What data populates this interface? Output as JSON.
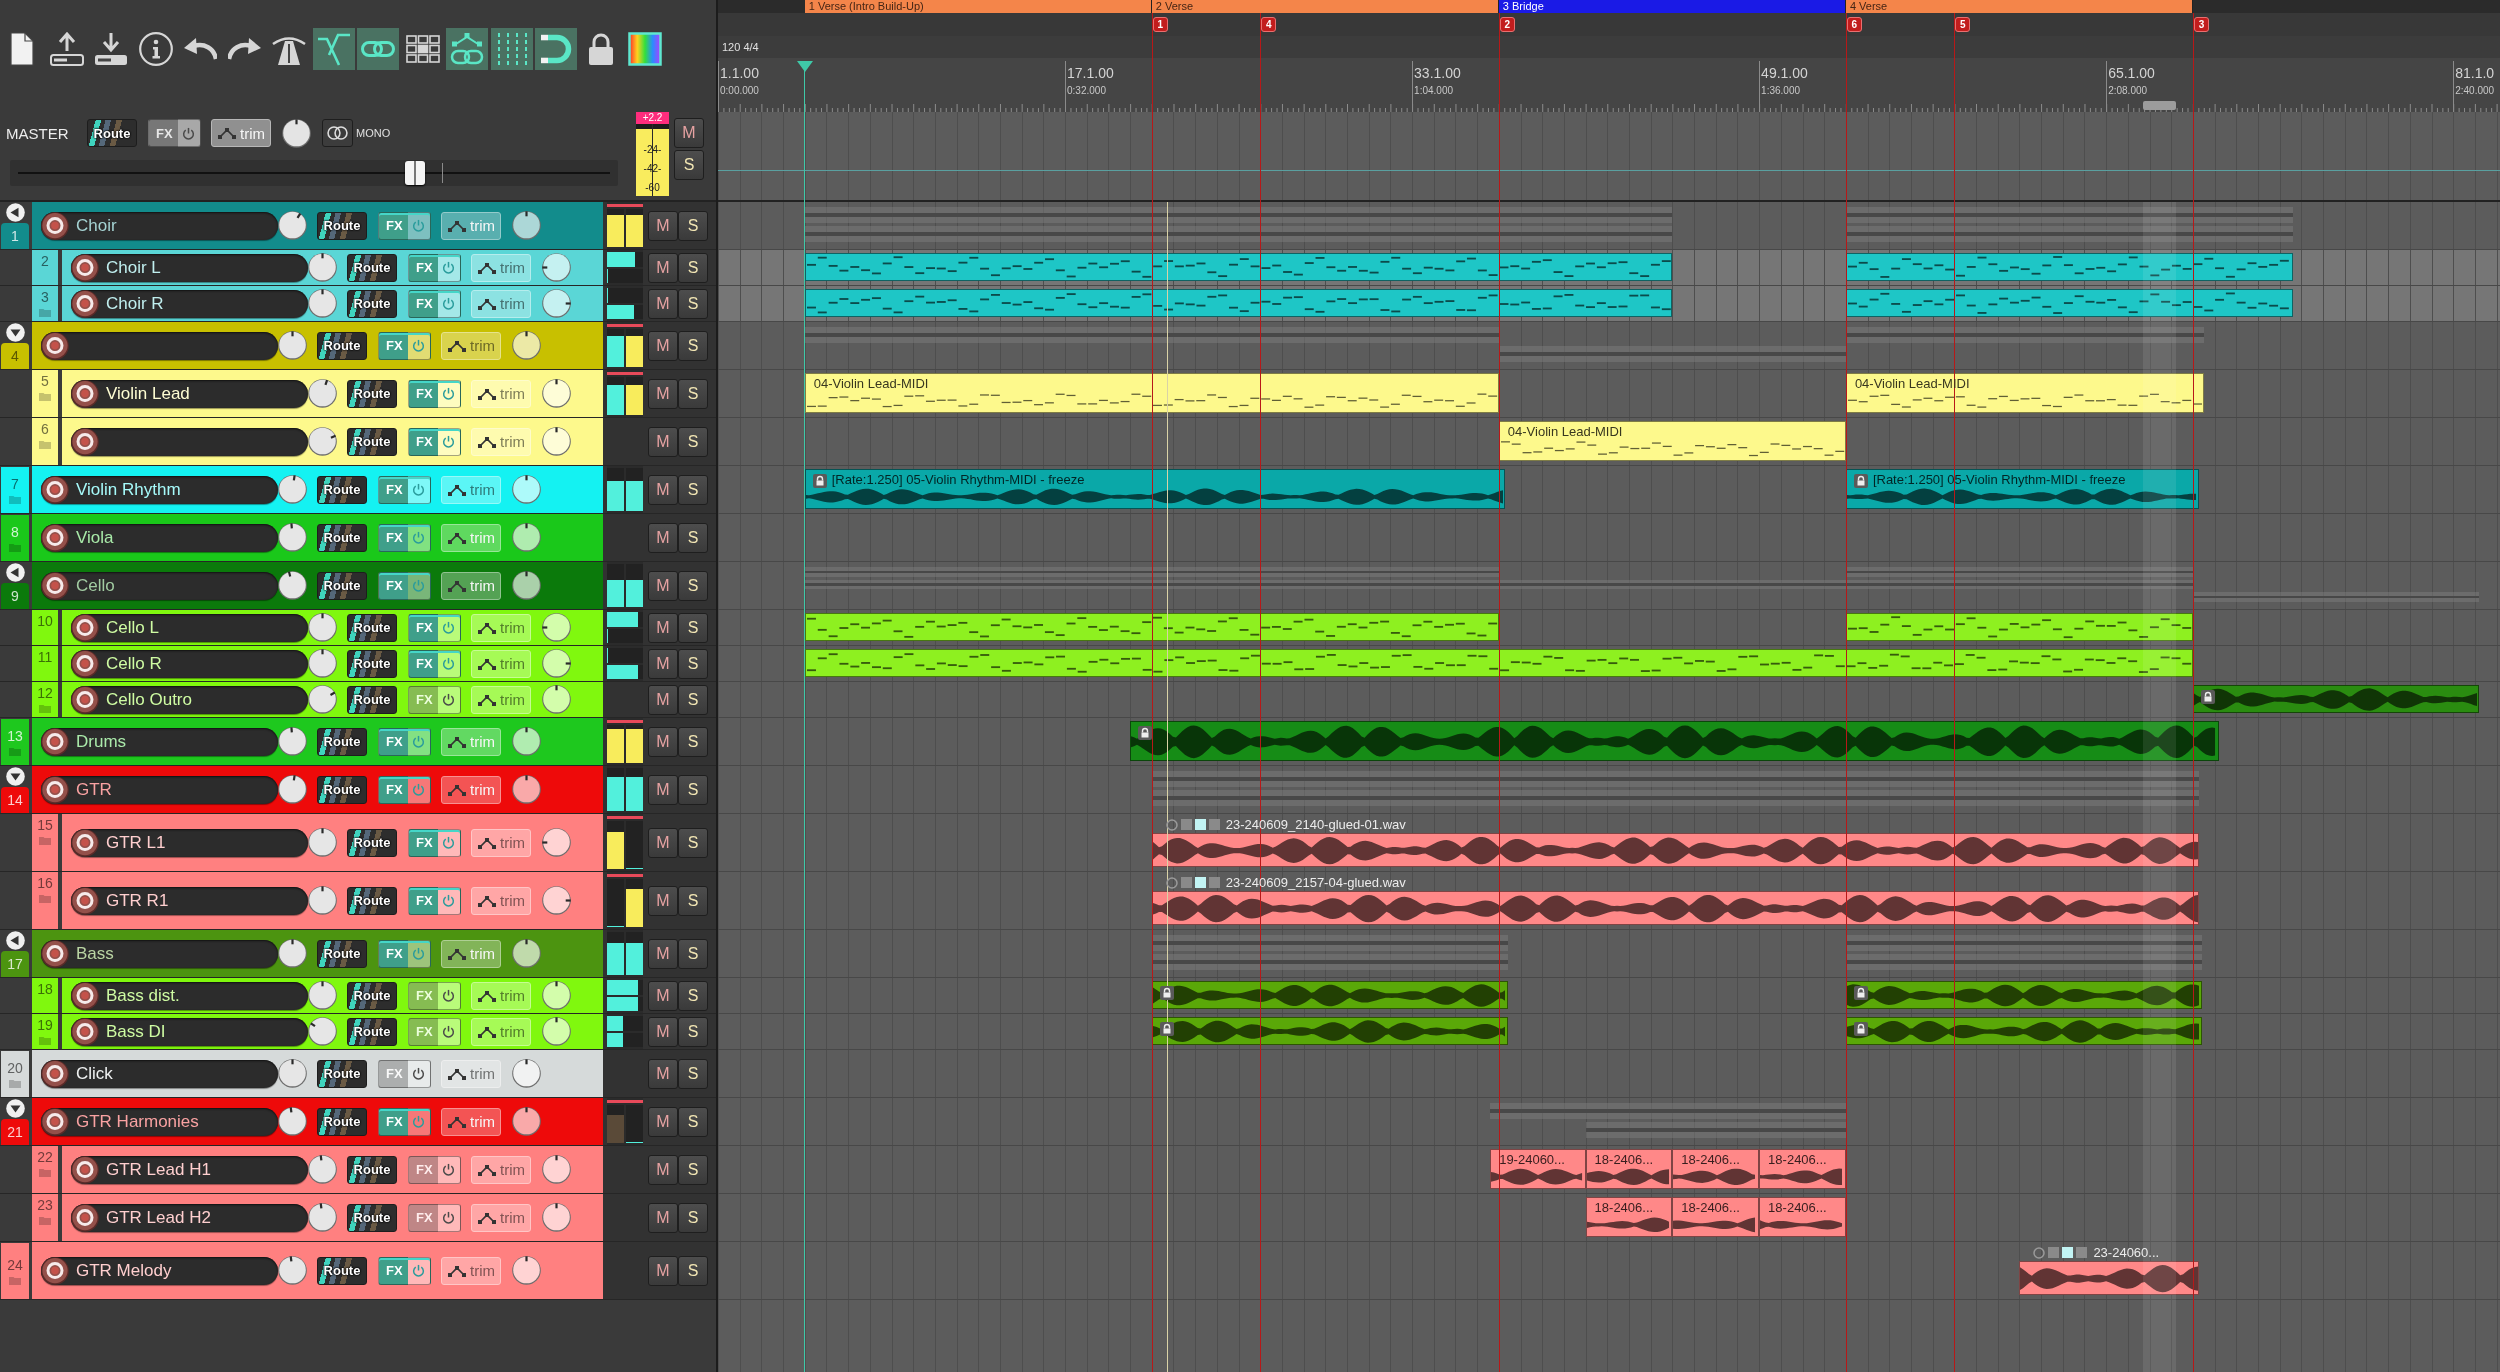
{
  "toolbar": [
    {
      "on": false
    },
    {
      "on": false
    },
    {
      "on": false
    },
    {
      "on": false
    },
    {
      "on": false
    },
    {
      "on": false
    },
    {
      "on": false
    },
    {
      "on": true
    },
    {
      "on": true
    },
    {
      "on": false
    },
    {
      "on": true
    },
    {
      "on": true
    },
    {
      "on": true
    },
    {
      "on": false
    },
    {
      "on": false
    }
  ],
  "master": {
    "label": "MASTER",
    "buttons": {
      "route": "Route",
      "fx": "FX",
      "trim": "trim",
      "mute": "M",
      "solo": "S"
    },
    "fx_active": false,
    "pan": {
      "level": 0.5
    },
    "mono": "MONO",
    "volume": {
      "level": 0.67
    },
    "meter": {
      "peak_label": "+2.2",
      "scale": [
        "-24-",
        "-42-",
        "-60"
      ],
      "channels": [
        {
          "level": 0.93
        },
        {
          "level": 0.93
        }
      ]
    }
  },
  "timeline": {
    "regions": [
      {
        "label": "1 Verse (Intro Build-Up)",
        "color": "#f4854a"
      },
      {
        "label": "2 Verse",
        "color": "#f4854a"
      },
      {
        "label": "3 Bridge",
        "color": "#1a1ae6"
      },
      {
        "label": "4 Verse",
        "color": "#f4854a"
      }
    ],
    "markers": [
      {
        "label": "1"
      },
      {
        "label": "4"
      },
      {
        "label": "2"
      },
      {
        "label": "6"
      },
      {
        "label": "5"
      },
      {
        "label": "3"
      }
    ],
    "tempo": "120 4/4",
    "ruler": [
      {
        "bar": "1.1.00",
        "time": "0:00.000"
      },
      {
        "bar": "17.1.00",
        "time": "0:32.000"
      },
      {
        "bar": "33.1.00",
        "time": "1:04.000"
      },
      {
        "bar": "49.1.00",
        "time": "1:36.000"
      },
      {
        "bar": "65.1.00",
        "time": "2:08.000"
      },
      {
        "bar": "81.1.0",
        "time": "2:40.000"
      }
    ]
  },
  "tracks": [
    {
      "number": "1",
      "name": "Choir",
      "color": "#128c8c",
      "selected": false,
      "compact": true,
      "fx_active": true,
      "volume": {
        "level": 0.72
      },
      "pan": {
        "level": 0.5
      },
      "buttons": {
        "route": "Route",
        "fx": "FX",
        "trim": "trim",
        "mute": "M",
        "solo": "S"
      },
      "meter": {
        "peak": true,
        "channels": [
          {
            "level": 0.85,
            "kind": "hot"
          },
          {
            "level": 0.85,
            "kind": "hot"
          }
        ]
      },
      "children": [
        {
          "number": "2",
          "name": "Choir L",
          "color": "#5ad6d6",
          "selected": true,
          "fx_active": true,
          "volume": {
            "level": 0.5
          },
          "pan": {
            "level": 0
          },
          "buttons": {
            "route": "Route",
            "fx": "FX",
            "trim": "trim",
            "mute": "M",
            "solo": "S"
          },
          "meter": {
            "peak": false,
            "channels": [
              {
                "level": 0.78,
                "kind": "normal"
              },
              {
                "level": 0,
                "kind": "normal"
              }
            ]
          },
          "items": [
            {
              "kind": "midi",
              "color": "#1ec6c6",
              "locked": false
            },
            {
              "kind": "midi",
              "color": "#1ec6c6",
              "locked": false
            }
          ]
        },
        {
          "number": "3",
          "name": "Choir R",
          "color": "#5ad6d6",
          "selected": true,
          "fx_active": true,
          "volume": {
            "level": 0.5
          },
          "pan": {
            "level": 1
          },
          "buttons": {
            "route": "Route",
            "fx": "FX",
            "trim": "trim",
            "mute": "M",
            "solo": "S"
          },
          "meter": {
            "peak": false,
            "channels": [
              {
                "level": 0,
                "kind": "normal"
              },
              {
                "level": 0.75,
                "kind": "normal"
              }
            ]
          },
          "items": [
            {
              "kind": "midi",
              "color": "#1ec6c6",
              "locked": false
            },
            {
              "kind": "midi",
              "color": "#1ec6c6",
              "locked": false
            }
          ]
        }
      ]
    },
    {
      "number": "4",
      "color": "#c8c000",
      "selected": false,
      "compact": false,
      "fx_active": true,
      "volume": {
        "level": 0.5
      },
      "pan": {
        "level": 0.5
      },
      "buttons": {
        "route": "Route",
        "fx": "FX",
        "trim": "trim",
        "mute": "M",
        "solo": "S"
      },
      "meter": {
        "peak": true,
        "channels": [
          {
            "level": 0.82,
            "kind": "normal"
          },
          {
            "level": 0.82,
            "kind": "hot"
          }
        ]
      },
      "children": [
        {
          "number": "5",
          "name": "Violin Lead",
          "color": "#fdf98c",
          "selected": false,
          "fx_active": true,
          "volume": {
            "level": 0.63
          },
          "pan": {
            "level": 0.5
          },
          "buttons": {
            "route": "Route",
            "fx": "FX",
            "trim": "trim",
            "mute": "M",
            "solo": "S"
          },
          "meter": {
            "peak": true,
            "channels": [
              {
                "level": 0.78,
                "kind": "normal"
              },
              {
                "level": 0.78,
                "kind": "hot"
              }
            ]
          },
          "items": [
            {
              "kind": "midi",
              "label": "04-Violin Lead-MIDI",
              "color": "#fdf98c",
              "locked": false
            },
            {
              "kind": "midi",
              "label": "04-Violin Lead-MIDI",
              "color": "#fdf98c",
              "locked": false
            }
          ]
        },
        {
          "number": "6",
          "color": "#fdf98c",
          "selected": false,
          "fx_active": true,
          "volume": {
            "level": 0.87
          },
          "pan": {
            "level": 0.5
          },
          "buttons": {
            "route": "Route",
            "fx": "FX",
            "trim": "trim",
            "mute": "M",
            "solo": "S"
          },
          "items": [
            {
              "kind": "midi",
              "label": "04-Violin Lead-MIDI",
              "color": "#fdf98c",
              "locked": false
            }
          ]
        }
      ]
    },
    {
      "number": "7",
      "name": "Violin Rhythm",
      "color": "#14f2f2",
      "selected": false,
      "fx_active": true,
      "volume": {
        "level": 0.56
      },
      "pan": {
        "level": 0.5
      },
      "buttons": {
        "route": "Route",
        "fx": "FX",
        "trim": "trim",
        "mute": "M",
        "solo": "S"
      },
      "meter": {
        "peak": false,
        "channels": [
          {
            "level": 0.7,
            "kind": "normal"
          },
          {
            "level": 0.7,
            "kind": "normal"
          }
        ]
      },
      "items": [
        {
          "kind": "audio",
          "label": "[Rate:1.250] 05-Violin Rhythm-MIDI - freeze",
          "color": "#0aa8a8",
          "locked": true
        },
        {
          "kind": "audio",
          "label": "[Rate:1.250] 05-Violin Rhythm-MIDI - freeze",
          "color": "#0aa8a8",
          "locked": true
        }
      ]
    },
    {
      "number": "8",
      "name": "Viola",
      "color": "#1ac81a",
      "selected": false,
      "fx_active": true,
      "volume": {
        "level": 0.47
      },
      "pan": {
        "level": 0.5
      },
      "buttons": {
        "route": "Route",
        "fx": "FX",
        "trim": "trim",
        "mute": "M",
        "solo": "S"
      }
    },
    {
      "number": "9",
      "name": "Cello",
      "color": "#0b7a0b",
      "selected": false,
      "compact": true,
      "fx_active": true,
      "volume": {
        "level": 0.4
      },
      "pan": {
        "level": 0.5
      },
      "buttons": {
        "route": "Route",
        "fx": "FX",
        "trim": "trim",
        "mute": "M",
        "solo": "S"
      },
      "meter": {
        "peak": false,
        "channels": [
          {
            "level": 0.62,
            "kind": "normal"
          },
          {
            "level": 0.62,
            "kind": "normal"
          }
        ]
      },
      "children": [
        {
          "number": "10",
          "name": "Cello L",
          "color": "#80f80e",
          "selected": false,
          "fx_active": true,
          "volume": {
            "level": 0.5
          },
          "pan": {
            "level": 0
          },
          "buttons": {
            "route": "Route",
            "fx": "FX",
            "trim": "trim",
            "mute": "M",
            "solo": "S"
          },
          "meter": {
            "peak": false,
            "channels": [
              {
                "level": 0.85,
                "kind": "normal"
              },
              {
                "level": 0,
                "kind": "normal"
              }
            ]
          },
          "items": [
            {
              "kind": "midi",
              "color": "#8ef020",
              "locked": false
            },
            {
              "kind": "midi",
              "color": "#8ef020",
              "locked": false
            }
          ]
        },
        {
          "number": "11",
          "name": "Cello R",
          "color": "#80f80e",
          "selected": false,
          "fx_active": true,
          "volume": {
            "level": 0.5
          },
          "pan": {
            "level": 1
          },
          "buttons": {
            "route": "Route",
            "fx": "FX",
            "trim": "trim",
            "mute": "M",
            "solo": "S"
          },
          "meter": {
            "peak": false,
            "channels": [
              {
                "level": 0,
                "kind": "normal"
              },
              {
                "level": 0.85,
                "kind": "normal"
              }
            ]
          },
          "items": [
            {
              "kind": "midi",
              "color": "#8ef020",
              "locked": false
            }
          ]
        },
        {
          "number": "12",
          "name": "Cello Outro",
          "color": "#80f80e",
          "selected": false,
          "fx_active": false,
          "volume": {
            "level": 0.85
          },
          "pan": {
            "level": 0.5
          },
          "buttons": {
            "route": "Route",
            "fx": "FX",
            "trim": "trim",
            "mute": "M",
            "solo": "S"
          },
          "items": [
            {
              "kind": "audio",
              "color": "#2a8c10",
              "locked": true
            }
          ]
        }
      ]
    },
    {
      "number": "13",
      "name": "Drums",
      "color": "#1ec81e",
      "selected": false,
      "fx_active": true,
      "volume": {
        "level": 0.47
      },
      "pan": {
        "level": 0.5
      },
      "buttons": {
        "route": "Route",
        "fx": "FX",
        "trim": "trim",
        "mute": "M",
        "solo": "S"
      },
      "meter": {
        "peak": true,
        "channels": [
          {
            "level": 0.9,
            "kind": "hot"
          },
          {
            "level": 0.9,
            "kind": "hot"
          }
        ]
      },
      "items": [
        {
          "kind": "audio",
          "color": "#168c16",
          "locked": true
        }
      ]
    },
    {
      "number": "14",
      "name": "GTR",
      "color": "#ee0a0a",
      "selected": false,
      "compact": false,
      "fx_active": true,
      "volume": {
        "level": 0.56
      },
      "pan": {
        "level": 0.5
      },
      "buttons": {
        "route": "Route",
        "fx": "FX",
        "trim": "trim",
        "mute": "M",
        "solo": "S"
      },
      "meter": {
        "peak": false,
        "channels": [
          {
            "level": 0.78,
            "kind": "normal"
          },
          {
            "level": 0.78,
            "kind": "normal"
          }
        ]
      },
      "children": [
        {
          "number": "15",
          "name": "GTR L1",
          "color": "#ff8080",
          "selected": false,
          "fx_active": true,
          "volume": {
            "level": 0.5
          },
          "pan": {
            "level": 0
          },
          "buttons": {
            "route": "Route",
            "fx": "FX",
            "trim": "trim",
            "mute": "M",
            "solo": "S"
          },
          "meter": {
            "peak": true,
            "channels": [
              {
                "level": 0.78,
                "kind": "hot"
              },
              {
                "level": 0,
                "kind": "normal"
              }
            ]
          },
          "items": [
            {
              "kind": "take",
              "label": "23-240609_2140-glued-01.wav",
              "color": "#ff8888",
              "locked": false
            }
          ]
        },
        {
          "number": "16",
          "name": "GTR R1",
          "color": "#ff8080",
          "selected": false,
          "fx_active": true,
          "volume": {
            "level": 0.5
          },
          "pan": {
            "level": 1
          },
          "buttons": {
            "route": "Route",
            "fx": "FX",
            "trim": "trim",
            "mute": "M",
            "solo": "S"
          },
          "meter": {
            "peak": true,
            "channels": [
              {
                "level": 0,
                "kind": "normal"
              },
              {
                "level": 0.8,
                "kind": "hot"
              }
            ]
          },
          "items": [
            {
              "kind": "take",
              "label": "23-240609_2157-04-glued.wav",
              "color": "#ff8888",
              "locked": false
            }
          ]
        }
      ]
    },
    {
      "number": "17",
      "name": "Bass",
      "color": "#4c9410",
      "selected": false,
      "compact": true,
      "fx_active": true,
      "volume": {
        "level": 0.5
      },
      "pan": {
        "level": 0.5
      },
      "buttons": {
        "route": "Route",
        "fx": "FX",
        "trim": "trim",
        "mute": "M",
        "solo": "S"
      },
      "meter": {
        "peak": false,
        "channels": [
          {
            "level": 0.75,
            "kind": "normal"
          },
          {
            "level": 0.75,
            "kind": "normal"
          }
        ]
      },
      "children": [
        {
          "number": "18",
          "name": "Bass dist.",
          "color": "#80f80e",
          "selected": false,
          "fx_active": false,
          "volume": {
            "level": 0.5
          },
          "pan": {
            "level": 0.5
          },
          "buttons": {
            "route": "Route",
            "fx": "FX",
            "trim": "trim",
            "mute": "M",
            "solo": "S"
          },
          "meter": {
            "peak": false,
            "channels": [
              {
                "level": 0.85,
                "kind": "normal"
              },
              {
                "level": 0.85,
                "kind": "normal"
              }
            ]
          },
          "items": [
            {
              "kind": "audio",
              "color": "#5aa808",
              "locked": true
            },
            {
              "kind": "audio",
              "color": "#5aa808",
              "locked": true
            }
          ]
        },
        {
          "number": "19",
          "name": "Bass DI",
          "color": "#80f80e",
          "selected": false,
          "fx_active": false,
          "volume": {
            "level": 0.17
          },
          "pan": {
            "level": 0.5
          },
          "buttons": {
            "route": "Route",
            "fx": "FX",
            "trim": "trim",
            "mute": "M",
            "solo": "S"
          },
          "meter": {
            "peak": false,
            "channels": [
              {
                "level": 0.45,
                "kind": "normal"
              },
              {
                "level": 0.45,
                "kind": "normal"
              }
            ]
          },
          "items": [
            {
              "kind": "audio",
              "color": "#5aa808",
              "locked": true
            },
            {
              "kind": "audio",
              "color": "#5aa808",
              "locked": true
            }
          ]
        }
      ]
    },
    {
      "number": "20",
      "name": "Click",
      "color": "#d6dada",
      "selected": false,
      "fx_active": false,
      "volume": {
        "level": 0.5
      },
      "pan": {
        "level": 0.5
      },
      "buttons": {
        "route": "Route",
        "fx": "FX",
        "trim": "trim",
        "mute": "M",
        "solo": "S"
      }
    },
    {
      "number": "21",
      "name": "GTR Harmonies",
      "color": "#ee0a0a",
      "selected": false,
      "compact": false,
      "fx_active": true,
      "volume": {
        "level": 0.45
      },
      "pan": {
        "level": 0.5
      },
      "buttons": {
        "route": "Route",
        "fx": "FX",
        "trim": "trim",
        "mute": "M",
        "solo": "S"
      },
      "meter": {
        "peak": true,
        "channels": [
          {
            "level": 0.75,
            "kind": "held"
          },
          {
            "level": 0,
            "kind": "normal"
          }
        ]
      },
      "children": [
        {
          "number": "22",
          "name": "GTR Lead H1",
          "color": "#ff8080",
          "selected": false,
          "fx_active": false,
          "volume": {
            "level": 0.45
          },
          "pan": {
            "level": 0.5
          },
          "buttons": {
            "route": "Route",
            "fx": "FX",
            "trim": "trim",
            "mute": "M",
            "solo": "S"
          },
          "items": [
            {
              "kind": "audio",
              "label": "19-24060...",
              "color": "#ff8888",
              "locked": false
            },
            {
              "kind": "audio",
              "label": "18-2406...",
              "color": "#ff8888",
              "locked": false
            },
            {
              "kind": "audio",
              "label": "18-2406...",
              "color": "#ff8888",
              "locked": false
            },
            {
              "kind": "audio",
              "label": "18-2406...",
              "color": "#ff8888",
              "locked": false
            }
          ]
        },
        {
          "number": "23",
          "name": "GTR Lead H2",
          "color": "#ff8080",
          "selected": false,
          "fx_active": false,
          "volume": {
            "level": 0.45
          },
          "pan": {
            "level": 0.5
          },
          "buttons": {
            "route": "Route",
            "fx": "FX",
            "trim": "trim",
            "mute": "M",
            "solo": "S"
          },
          "items": [
            {
              "kind": "audio",
              "label": "18-2406...",
              "color": "#ff8888",
              "locked": false
            },
            {
              "kind": "audio",
              "label": "18-2406...",
              "color": "#ff8888",
              "locked": false
            },
            {
              "kind": "audio",
              "label": "18-2406...",
              "color": "#ff8888",
              "locked": false
            }
          ]
        }
      ]
    },
    {
      "number": "24",
      "name": "GTR Melody",
      "color": "#ff8080",
      "selected": false,
      "fx_active": true,
      "volume": {
        "level": 0.45
      },
      "pan": {
        "level": 0.5
      },
      "buttons": {
        "route": "Route",
        "fx": "FX",
        "trim": "trim",
        "mute": "M",
        "solo": "S"
      },
      "items": [
        {
          "kind": "take",
          "label": "23-24060...",
          "color": "#ff8888",
          "locked": false
        }
      ]
    }
  ]
}
